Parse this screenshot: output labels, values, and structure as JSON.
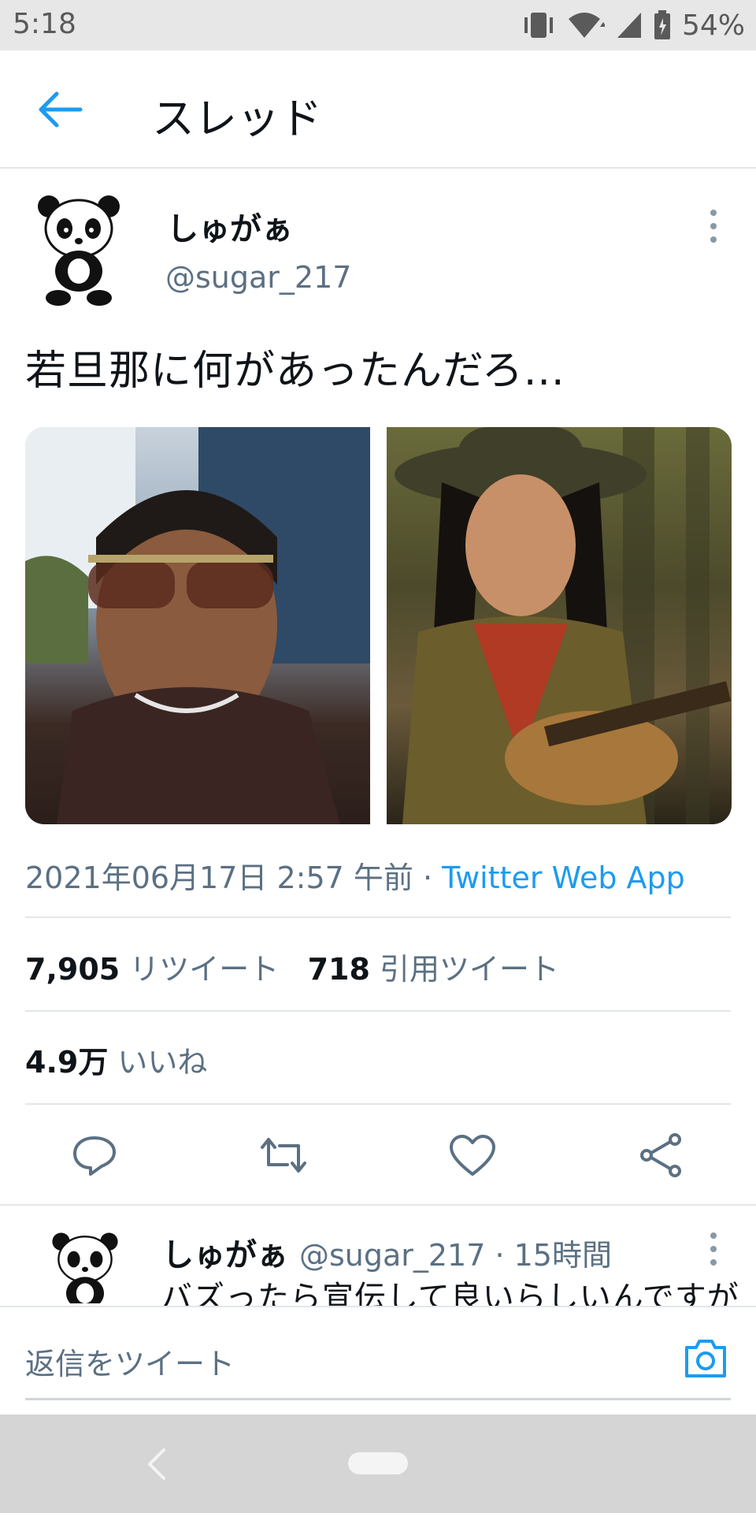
{
  "status_bar": {
    "time": "5:18",
    "battery_pct": "54%",
    "icons": [
      "vibrate-icon",
      "wifi-icon",
      "signal-icon",
      "battery-icon"
    ]
  },
  "header": {
    "title": "スレッド",
    "back_icon": "arrow-left-icon"
  },
  "tweet": {
    "author_name": "しゅがぁ",
    "author_handle": "@sugar_217",
    "text": "若旦那に何があったんだろ...",
    "timestamp": "2021年06月17日 2:57 午前 · ",
    "source": "Twitter Web App",
    "retweet_count": "7,905",
    "retweet_label": "リツイート",
    "quote_count": "718",
    "quote_label": "引用ツイート",
    "like_count": "4.9万",
    "like_label": "いいね",
    "media": [
      "photo-1",
      "photo-2"
    ]
  },
  "actions": [
    "reply-icon",
    "retweet-icon",
    "like-icon",
    "share-icon"
  ],
  "reply": {
    "author_name": "しゅがぁ",
    "meta": "@sugar_217 · 15時間",
    "text": "バズったら宣伝して良いらしいんですが"
  },
  "composer": {
    "placeholder": "返信をツイート",
    "camera_icon": "camera-icon"
  },
  "colors": {
    "accent": "#1d9bf0",
    "secondary_text": "#5b7083",
    "divider": "#e3e6e9"
  }
}
